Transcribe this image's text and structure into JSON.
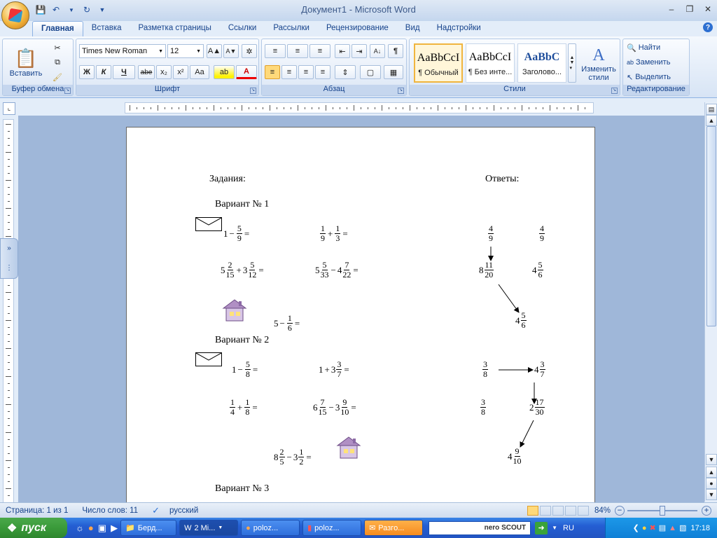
{
  "app": {
    "title": "Документ1 - Microsoft Word"
  },
  "tabs": [
    "Главная",
    "Вставка",
    "Разметка страницы",
    "Ссылки",
    "Рассылки",
    "Рецензирование",
    "Вид",
    "Надстройки"
  ],
  "ribbon": {
    "clipboard": {
      "paste": "Вставить",
      "label": "Буфер обмена"
    },
    "font": {
      "family": "Times New Roman",
      "size": "12",
      "label": "Шрифт",
      "bold": "Ж",
      "italic": "К",
      "underline": "Ч",
      "strike": "abe",
      "sub": "x₂",
      "sup": "x²",
      "case": "Aa"
    },
    "paragraph": {
      "label": "Абзац"
    },
    "styles": {
      "label": "Стили",
      "items": [
        {
          "sample": "AaBbCcI",
          "name": "¶ Обычный"
        },
        {
          "sample": "AaBbCcI",
          "name": "¶ Без инте..."
        },
        {
          "sample": "AaBbC",
          "name": "Заголово..."
        }
      ],
      "change": "Изменить стили"
    },
    "editing": {
      "label": "Редактирование",
      "find": "Найти",
      "replace": "Заменить",
      "select": "Выделить"
    }
  },
  "document": {
    "tasks_heading": "Задания:",
    "answers_heading": "Ответы:",
    "variant1": "Вариант № 1",
    "variant2": "Вариант № 2",
    "variant3": "Вариант № 3"
  },
  "statusbar": {
    "page": "Страница: 1 из 1",
    "words": "Число слов: 11",
    "lang": "русский",
    "zoom": "84%"
  },
  "taskbar": {
    "start": "пуск",
    "items": [
      "Берд...",
      "2 Mi...",
      "poloz...",
      "poloz...",
      "Разго..."
    ],
    "nero": "nero SCOUT",
    "lang": "RU",
    "time": "17:18"
  }
}
